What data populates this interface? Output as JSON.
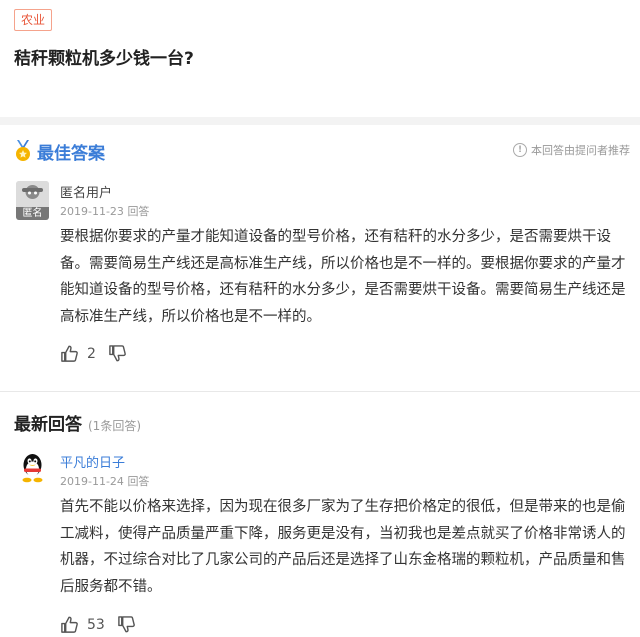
{
  "question": {
    "tag": "农业",
    "title": "秸秆颗粒机多少钱一台?"
  },
  "best_answer": {
    "heading": "最佳答案",
    "note": "本回答由提问者推荐",
    "user": "匿名用户",
    "avatar_label": "匿名",
    "date": "2019-11-23",
    "meta_suffix": "回答",
    "text": "要根据你要求的产量才能知道设备的型号价格，还有秸秆的水分多少，是否需要烘干设备。需要简易生产线还是高标准生产线，所以价格也是不一样的。要根据你要求的产量才能知道设备的型号价格，还有秸秆的水分多少，是否需要烘干设备。需要简易生产线还是高标准生产线，所以价格也是不一样的。",
    "upvotes": "2"
  },
  "latest": {
    "heading": "最新回答",
    "count": "(1条回答)",
    "answers": [
      {
        "user": "平凡的日子",
        "date": "2019-11-24",
        "meta_suffix": "回答",
        "text": "首先不能以价格来选择，因为现在很多厂家为了生存把价格定的很低，但是带来的也是偷工减料，使得产品质量严重下降，服务更是没有，当初我也是差点就买了价格非常诱人的机器，不过综合对比了几家公司的产品后还是选择了山东金格瑞的颗粒机，产品质量和售后服务都不错。",
        "upvotes": "53"
      }
    ]
  },
  "colors": {
    "accent_blue": "#3b7dd8",
    "tag_red": "#e8583b"
  }
}
